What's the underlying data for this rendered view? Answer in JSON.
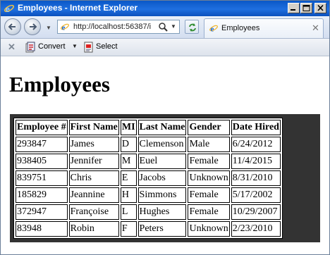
{
  "window": {
    "title": "Employees - Internet Explorer"
  },
  "address_bar": {
    "url": "http://localhost:56387/i"
  },
  "tab": {
    "label": "Employees"
  },
  "command_bar": {
    "convert_label": "Convert",
    "select_label": "Select"
  },
  "page": {
    "title": "Employees"
  },
  "table": {
    "headers": [
      "Employee #",
      "First Name",
      "MI",
      "Last Name",
      "Gender",
      "Date Hired"
    ],
    "rows": [
      [
        "293847",
        "James",
        "D",
        "Clemenson",
        "Male",
        "6/24/2012"
      ],
      [
        "938405",
        "Jennifer",
        "M",
        "Euel",
        "Female",
        "11/4/2015"
      ],
      [
        "839751",
        "Chris",
        "E",
        "Jacobs",
        "Unknown",
        "8/31/2010"
      ],
      [
        "185829",
        "Jeannine",
        "H",
        "Simmons",
        "Female",
        "5/17/2002"
      ],
      [
        "372947",
        "Françoise",
        "L",
        "Hughes",
        "Female",
        "10/29/2007"
      ],
      [
        "83948",
        "Robin",
        "F",
        "Peters",
        "Unknown",
        "2/23/2010"
      ]
    ]
  },
  "icons": {
    "app": "ie-logo-icon",
    "back": "back-arrow-icon",
    "forward": "forward-arrow-icon",
    "address_page": "ie-page-icon",
    "search": "search-icon",
    "refresh": "refresh-icon",
    "stop": "stop-icon",
    "convert": "pdf-convert-icon",
    "select": "pdf-select-icon"
  }
}
